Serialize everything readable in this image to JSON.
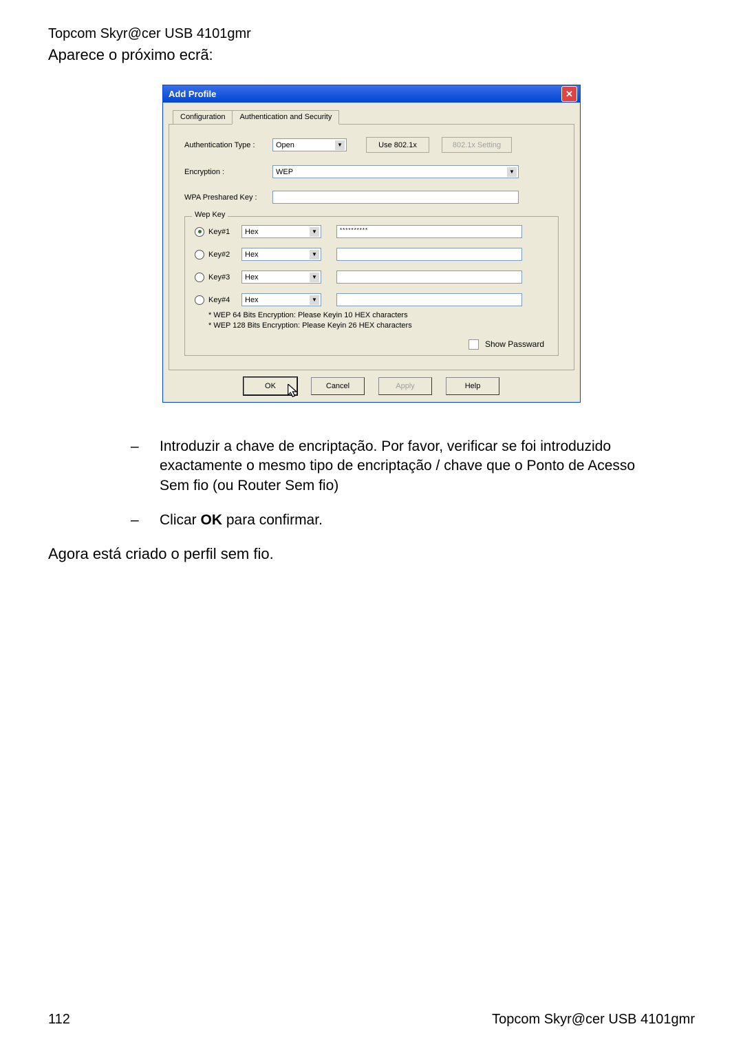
{
  "header_product": "Topcom Skyr@cer USB 4101gmr",
  "intro": "Aparece o próximo ecrã:",
  "dialog": {
    "title": "Add Profile",
    "tabs": {
      "config": "Configuration",
      "auth": "Authentication and Security"
    },
    "auth_type_label": "Authentication Type :",
    "auth_type_value": "Open",
    "use_8021x": "Use 802.1x",
    "setting_8021x": "802.1x Setting",
    "encryption_label": "Encryption :",
    "encryption_value": "WEP",
    "wpa_label": "WPA Preshared Key :",
    "wpa_value": "",
    "wepkey_legend": "Wep Key",
    "keys": [
      {
        "label": "Key#1",
        "format": "Hex",
        "value": "**********",
        "checked": true
      },
      {
        "label": "Key#2",
        "format": "Hex",
        "value": "",
        "checked": false
      },
      {
        "label": "Key#3",
        "format": "Hex",
        "value": "",
        "checked": false
      },
      {
        "label": "Key#4",
        "format": "Hex",
        "value": "",
        "checked": false
      }
    ],
    "hint1": "* WEP 64 Bits Encryption:   Please Keyin 10 HEX characters",
    "hint2": "* WEP 128 Bits Encryption:   Please Keyin 26 HEX characters",
    "show_password": "Show Passward",
    "buttons": {
      "ok": "OK",
      "cancel": "Cancel",
      "apply": "Apply",
      "help": "Help"
    }
  },
  "instructions": {
    "item1": "Introduzir a chave de encriptação. Por favor, verificar se foi introduzido exactamente o mesmo tipo de encriptação / chave que o Ponto de Acesso Sem fio (ou Router Sem fio)",
    "item2_prefix": "Clicar ",
    "item2_bold": "OK",
    "item2_suffix": " para confirmar."
  },
  "closing": "Agora está criado o perfil sem fio.",
  "footer": {
    "page": "112",
    "product": "Topcom Skyr@cer USB 4101gmr"
  }
}
